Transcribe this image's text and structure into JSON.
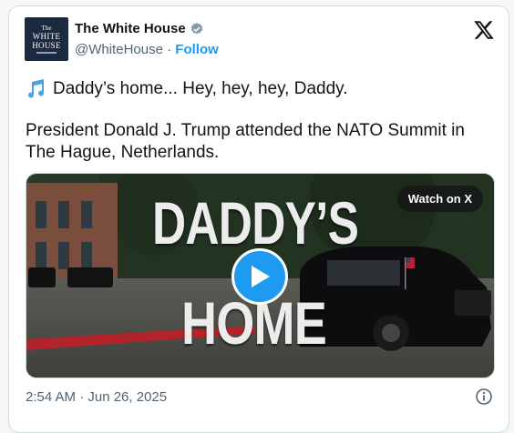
{
  "account": {
    "avatar_line1": "The",
    "avatar_line2": "WHITE",
    "avatar_line3": "HOUSE",
    "name": "The White House",
    "verified_icon": "verified-badge-icon",
    "handle": "@WhiteHouse",
    "separator": " · ",
    "follow_label": "Follow"
  },
  "post": {
    "line1": "Daddy’s home... Hey, hey, hey, Daddy.",
    "line2": "President Donald J. Trump attended the NATO Summit in The Hague, Netherlands.",
    "timestamp": "2:54 AM · Jun 26, 2025"
  },
  "media": {
    "watch_label": "Watch on X",
    "overlay_line1": "DADDY’S",
    "overlay_line2": "HOME"
  },
  "colors": {
    "accent": "#1d9bf0",
    "muted": "#536471",
    "border": "#cfd9de"
  }
}
